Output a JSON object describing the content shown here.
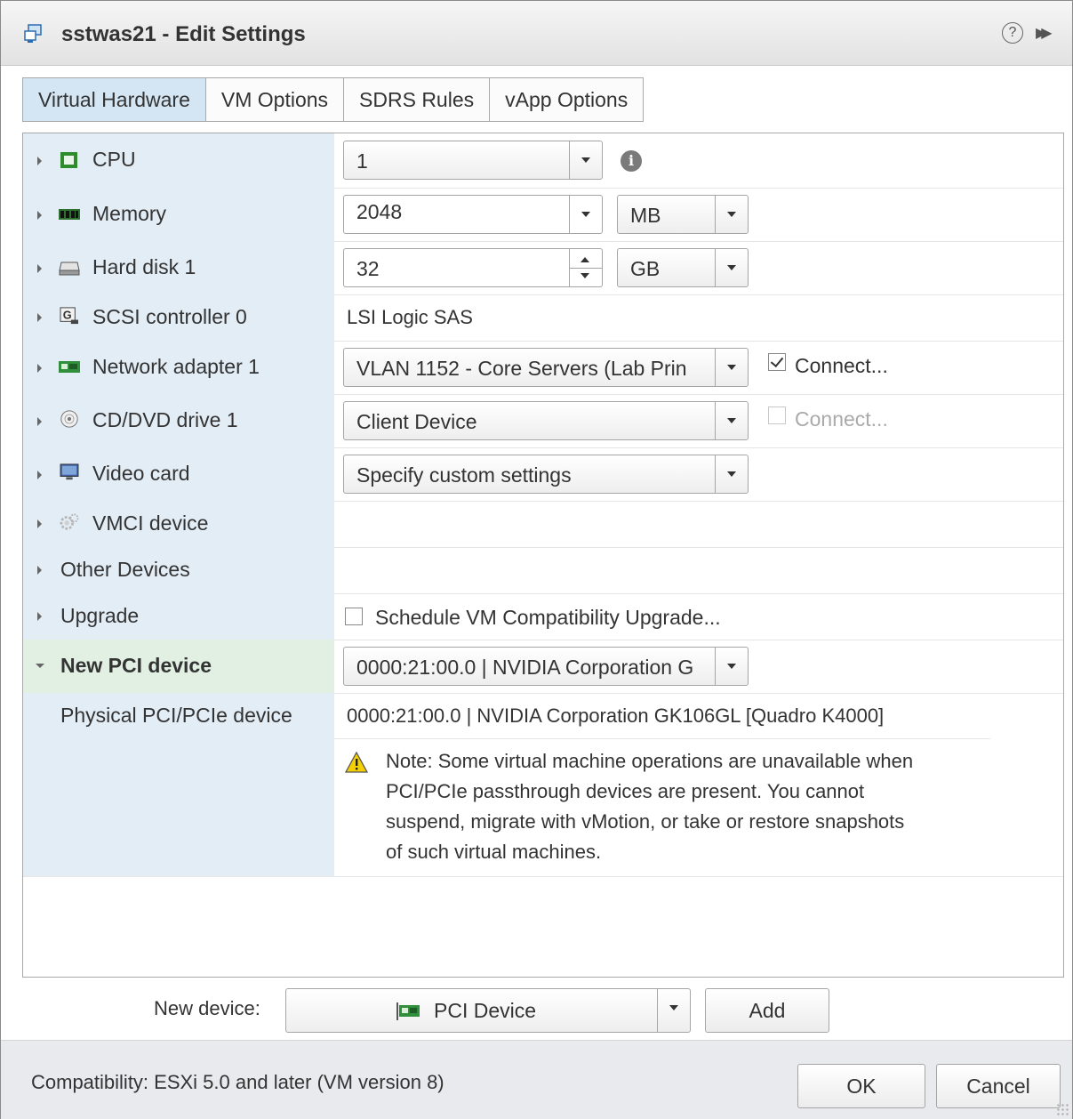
{
  "title": "sstwas21 - Edit Settings",
  "tabs": [
    "Virtual Hardware",
    "VM Options",
    "SDRS Rules",
    "vApp Options"
  ],
  "rows": {
    "cpu": {
      "label": "CPU",
      "value": "1"
    },
    "memory": {
      "label": "Memory",
      "value": "2048",
      "unit": "MB"
    },
    "hard_disk": {
      "label": "Hard disk 1",
      "value": "32",
      "unit": "GB"
    },
    "scsi": {
      "label": "SCSI controller 0",
      "value": "LSI Logic SAS"
    },
    "network": {
      "label": "Network adapter 1",
      "value": "VLAN 1152 - Core Servers (Lab Prin",
      "connect_label": "Connect...",
      "connected": true
    },
    "cddvd": {
      "label": "CD/DVD drive 1",
      "value": "Client Device",
      "connect_label": "Connect...",
      "connected": false
    },
    "video": {
      "label": "Video card",
      "value": "Specify custom settings"
    },
    "vmci": {
      "label": "VMCI device"
    },
    "other": {
      "label": "Other Devices"
    },
    "upgrade": {
      "label": "Upgrade",
      "checkbox_label": "Schedule VM Compatibility Upgrade...",
      "checked": false
    },
    "new_pci": {
      "label": "New PCI device",
      "value": "0000:21:00.0 | NVIDIA Corporation G"
    },
    "physical_pci": {
      "label": "Physical PCI/PCIe device",
      "value": "0000:21:00.0 | NVIDIA Corporation GK106GL [Quadro K4000]"
    },
    "note": {
      "line1": "Note: Some virtual machine operations are unavailable when",
      "line2": "PCI/PCIe passthrough devices are present. You cannot",
      "line3": "suspend, migrate with vMotion, or take or restore snapshots",
      "line4": "of such virtual machines."
    }
  },
  "new_device": {
    "label": "New device:",
    "value": "PCI Device",
    "add_label": "Add"
  },
  "footer": {
    "compatibility": "Compatibility: ESXi 5.0 and later (VM version 8)",
    "ok_label": "OK",
    "cancel_label": "Cancel"
  },
  "icons": {
    "title": "vm-icon",
    "help": "help-icon",
    "expand": "expand-icon",
    "info": "info-icon",
    "warning": "warning-icon"
  }
}
